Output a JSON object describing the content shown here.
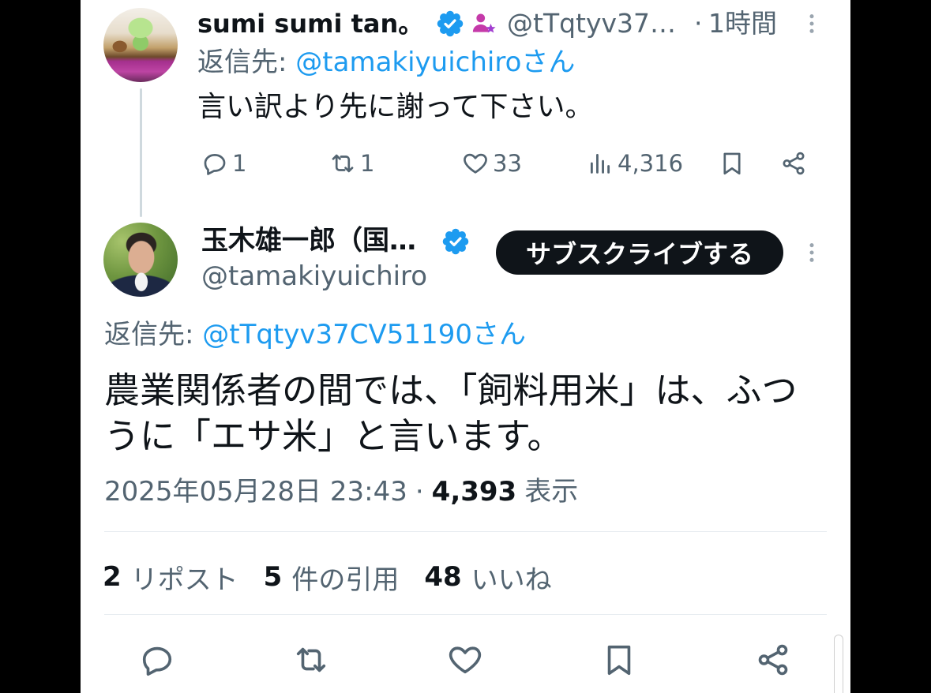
{
  "reply": {
    "author": {
      "name": "sumi sumi tan。",
      "handle": "@tTqtyv37…",
      "time_sep": "·",
      "time": "1時間"
    },
    "reply_to": {
      "label": "返信先:",
      "mention": "@tamakiyuichiroさん"
    },
    "text": "言い訳より先に謝って下さい。",
    "actions": {
      "replies": "1",
      "reposts": "1",
      "likes": "33",
      "views": "4,316"
    }
  },
  "main": {
    "author": {
      "name": "玉木雄一郎（国…",
      "handle": "@tamakiyuichiro"
    },
    "subscribe_label": "サブスクライブする",
    "reply_to": {
      "label": "返信先:",
      "mention": "@tTqtyv37CV51190さん"
    },
    "text": "農業関係者の間では、「飼料用米」は、ふつうに「エサ米」と言います。",
    "timestamp": "2025年05月28日 23:43",
    "meta_sep": "·",
    "views": {
      "count": "4,393",
      "label": "表示"
    },
    "stats": [
      {
        "count": "2",
        "label": "リポスト"
      },
      {
        "count": "5",
        "label": "件の引用"
      },
      {
        "count": "48",
        "label": "いいね"
      }
    ]
  },
  "icons": {
    "verified": "verified-badge-icon",
    "subscriber": "subscriber-badge-icon",
    "more": "more-icon",
    "reply": "reply-icon",
    "repost": "repost-icon",
    "like": "like-icon",
    "views": "views-icon",
    "bookmark": "bookmark-icon",
    "share": "share-icon"
  },
  "colors": {
    "text": "#0f1419",
    "secondary": "#536471",
    "accent": "#1d9bf0",
    "subscriber_badge": "#c53aa9",
    "subscribe_button": "#0f1419",
    "thread_line": "#cfd9de"
  }
}
